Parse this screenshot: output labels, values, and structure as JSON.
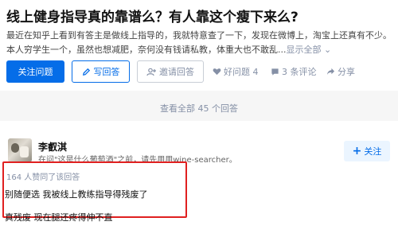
{
  "question": {
    "title": "线上健身指导真的靠谱么？有人靠这个瘦下来么?",
    "excerpt_line1": "最近在知乎上看到有答主是做线上指导的，我就特意查了一下，发现在微博上，淘宝上还真有不少。",
    "excerpt_line2": "本人穷学生一个，虽然也想减肥，奈何没有钱请私教，体重大也不敢乱...",
    "show_all": "显示全部",
    "chevron": "⌄"
  },
  "actions": {
    "follow_label": "关注问题",
    "write_label": "写回答",
    "invite_label": "邀请回答",
    "good_question": "好问题 4",
    "comments": "3 条评论",
    "share": "分享"
  },
  "view_all": "查看全部 45 个回答",
  "answer": {
    "author_name": "李叡淇",
    "author_bio": "在问\"这是什么葡萄酒\"之前，请先用用wine-searcher。",
    "follow_label": "关注",
    "follow_plus": "+",
    "vote_text": "164 人赞同了该回答",
    "line1": "别随便选 我被线上教练指导得残废了",
    "line2": "真残废 现在腿还疼得伸不直"
  },
  "colors": {
    "brand_blue": "#056de8",
    "highlight_red": "#e02020",
    "muted": "#8590a6"
  }
}
